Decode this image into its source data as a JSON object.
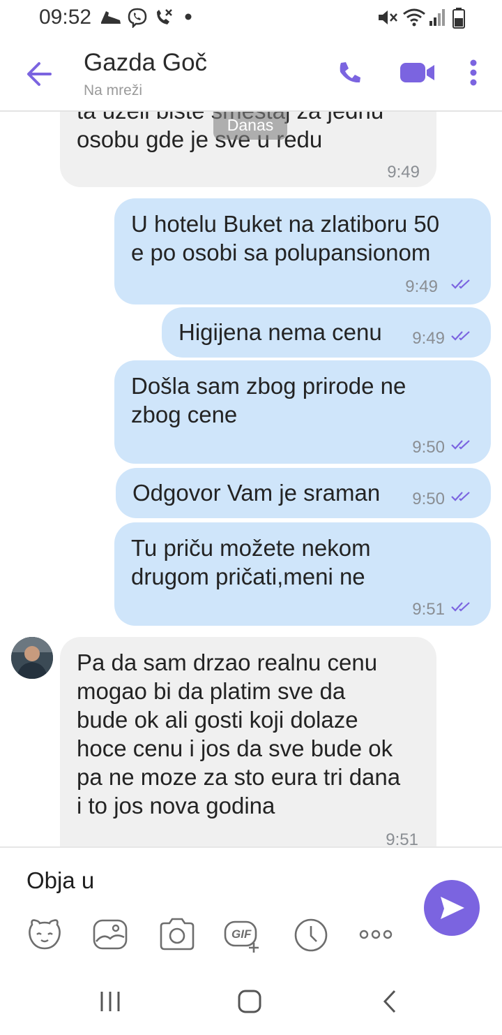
{
  "status_bar": {
    "time": "09:52",
    "left_icons": [
      "shoe-icon",
      "viber-icon",
      "missed-call-icon",
      "dot-icon"
    ],
    "right_icons": [
      "mute-icon",
      "wifi-icon",
      "signal-icon",
      "battery-icon"
    ]
  },
  "header": {
    "contact_name": "Gazda Goč",
    "contact_status": "Na mreži",
    "accent_color": "#7b64e0"
  },
  "chat": {
    "date_label": "Danas",
    "messages": [
      {
        "direction": "in",
        "text": "ta uzeli biste smeštaj za jednu\nosobu gde je sve u redu",
        "time": "9:49"
      },
      {
        "direction": "out",
        "text": "U hotelu Buket na zlatiboru 50\ne po osobi sa polupansionom",
        "time": "9:49"
      },
      {
        "direction": "out",
        "text": "Higijena nema cenu",
        "time": "9:49"
      },
      {
        "direction": "out",
        "text": "Došla sam zbog prirode ne\nzbog cene",
        "time": "9:50"
      },
      {
        "direction": "out",
        "text": "Odgovor Vam je sraman",
        "time": "9:50"
      },
      {
        "direction": "out",
        "text": "Tu priču možete nekom\ndrugom pričati,meni ne",
        "time": "9:51"
      },
      {
        "direction": "in",
        "text": "Pa da sam drzao realnu cenu\nmogao bi da platim sve da\nbude ok ali gosti koji dolaze\nhoce cenu i jos da sve bude ok\npa ne moze za sto eura tri dana\ni to jos nova godina",
        "time": "9:51"
      }
    ]
  },
  "composer": {
    "input_value": "Obja u",
    "toolbar_icons": [
      "sticker-icon",
      "gallery-icon",
      "camera-icon",
      "gif-icon",
      "timer-icon",
      "more-icon"
    ],
    "gif_label": "GIF"
  },
  "nav_bar": {
    "icons": [
      "recents-icon",
      "home-icon",
      "back-nav-icon"
    ]
  }
}
